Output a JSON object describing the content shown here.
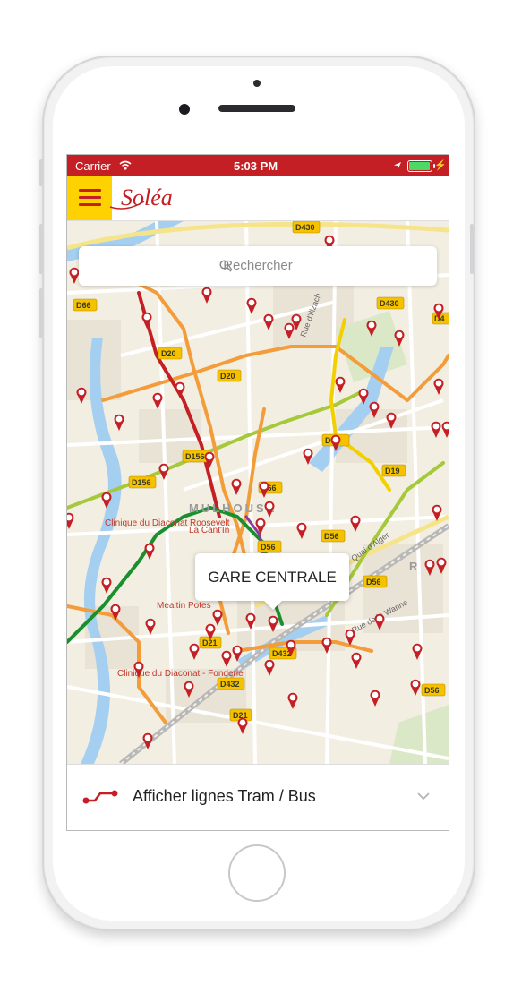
{
  "status_bar": {
    "carrier": "Carrier",
    "time": "5:03 PM"
  },
  "app": {
    "logo_text": "Soléa",
    "menu_icon": "hamburger-icon"
  },
  "search": {
    "placeholder": "Rechercher",
    "icon": "search-icon"
  },
  "map": {
    "callout": "GARE CENTRALE",
    "road_labels": [
      "D430",
      "D430",
      "D66",
      "D20",
      "D20",
      "D156",
      "D156",
      "D66",
      "D56",
      "D56",
      "D56",
      "D56",
      "D432",
      "D432",
      "D21",
      "D21",
      "D4",
      "D19",
      "D21"
    ],
    "street_labels": [
      "Rue d'Illzach",
      "Quai d'Alger",
      "Rue de la Wanne"
    ],
    "place_labels": [
      "Clinique du Diaconat Roosevelt",
      "La Cant'In",
      "Mealtin Potes",
      "Clinique du Diaconat - Fonderie"
    ],
    "district_labels": [
      "MULHOUSE",
      "R"
    ]
  },
  "bottom_bar": {
    "label": "Afficher lignes Tram / Bus",
    "icon": "route-icon",
    "chevron": "chevron-down-icon"
  },
  "colors": {
    "brand_red": "#c41f25",
    "brand_yellow": "#fdd200",
    "tram_green": "#1a8f2e",
    "line_orange": "#f39c3a",
    "line_lime": "#a5c93a",
    "line_yellow": "#f2d000"
  }
}
